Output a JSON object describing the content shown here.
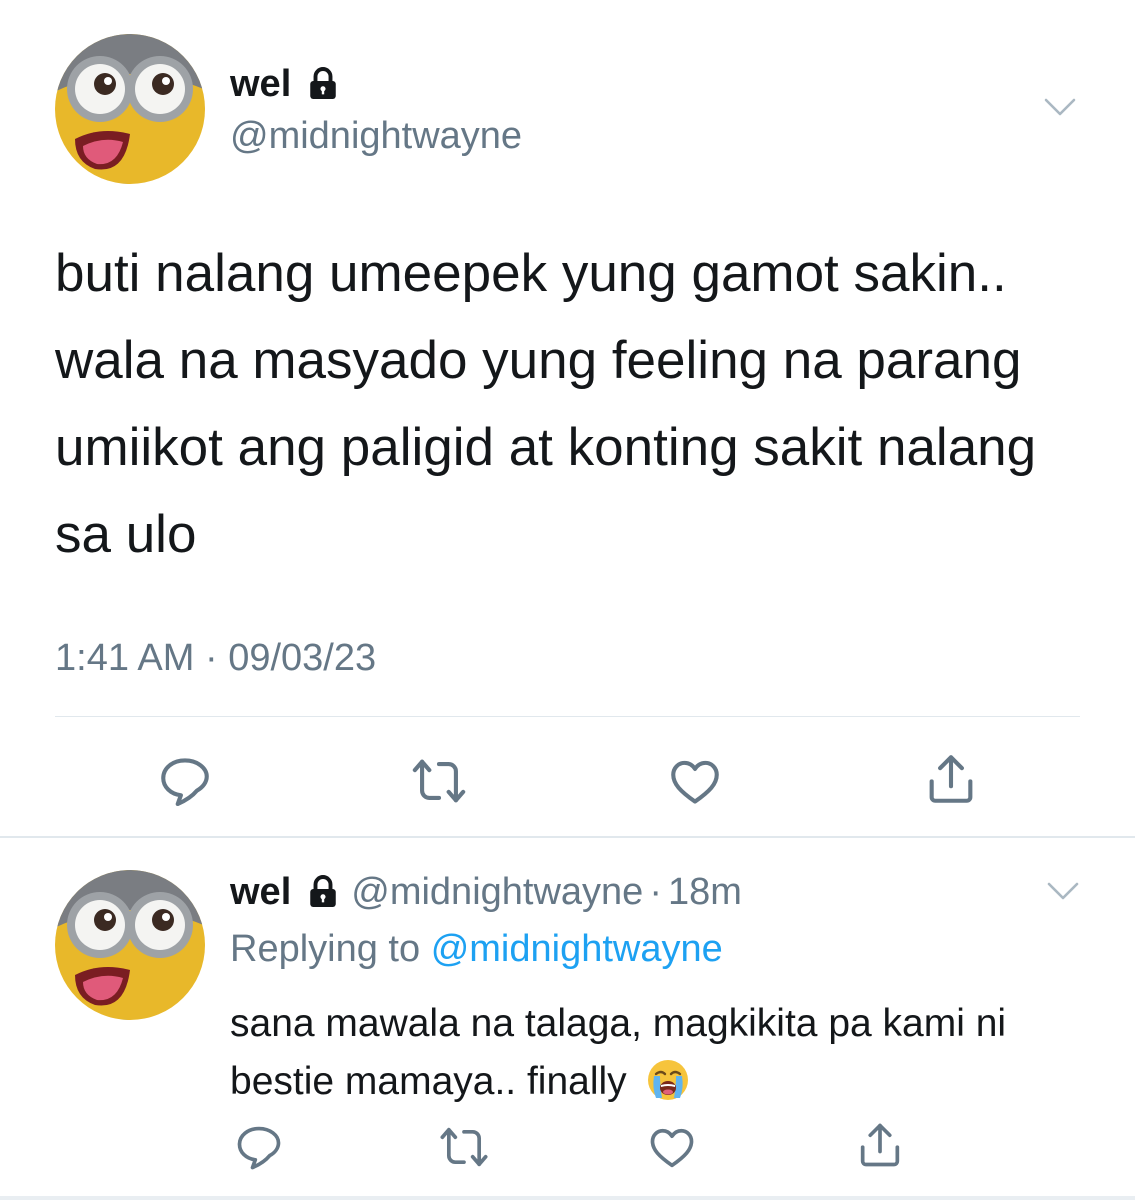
{
  "main_tweet": {
    "display_name": "wel",
    "handle": "@midnightwayne",
    "text": "buti nalang umeepek yung gamot sakin.. wala na masyado yung feeling na parang umiikot ang paligid at konting sakit nalang sa ulo",
    "timestamp": "1:41 AM · 09/03/23",
    "protected_icon": "lock-icon",
    "actions": [
      "reply-icon",
      "retweet-icon",
      "like-icon",
      "share-icon"
    ]
  },
  "reply_tweet": {
    "display_name": "wel",
    "handle": "@midnightwayne",
    "separator": "·",
    "relative_time": "18m",
    "replying_prefix": "Replying to",
    "replying_to": "@midnightwayne",
    "text": "sana mawala na talaga, magkikita pa kami ni bestie mamaya.. finally",
    "emoji": "loudly-crying-face-emoji",
    "protected_icon": "lock-icon",
    "actions": [
      "reply-icon",
      "retweet-icon",
      "like-icon",
      "share-icon"
    ]
  },
  "colors": {
    "text_primary": "#14171a",
    "text_secondary": "#657786",
    "link": "#1da1f2",
    "divider": "#e1e8ed"
  }
}
